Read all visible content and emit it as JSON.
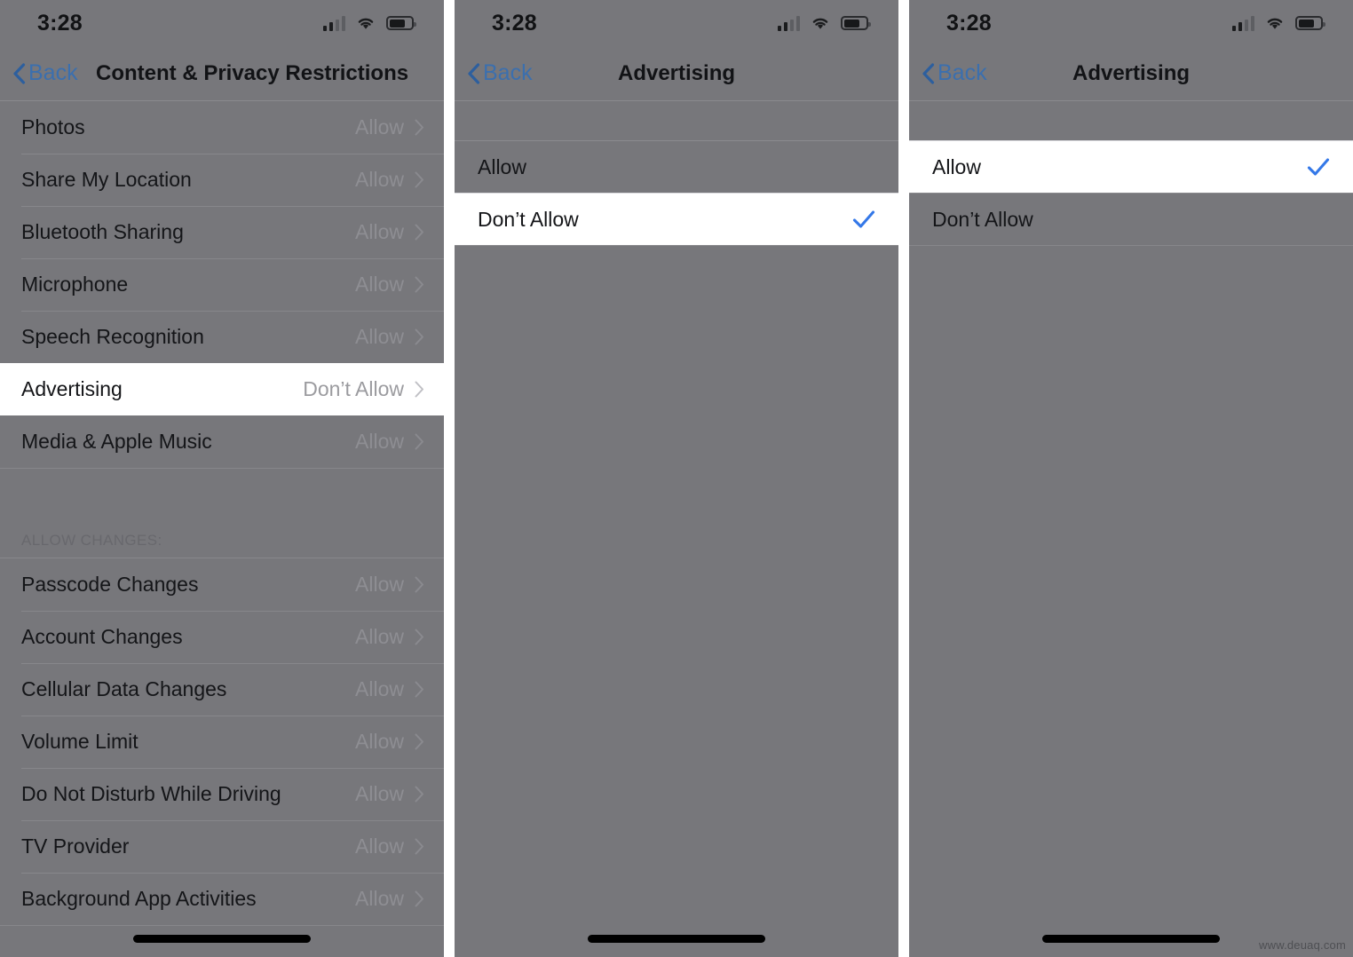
{
  "status_bar": {
    "time": "3:28",
    "icons": [
      "cellular-signal-icon",
      "wifi-icon",
      "battery-icon"
    ]
  },
  "colors": {
    "dim_overlay": "#77777b",
    "highlight_bg": "#ffffff",
    "accent_blue": "#3478e8",
    "back_link": "#3b6fae",
    "value_gray": "#8e8e93"
  },
  "panels": [
    {
      "id": "content-privacy-restrictions",
      "nav": {
        "back_label": "Back",
        "title": "Content & Privacy Restrictions"
      },
      "sections": [
        {
          "header": "",
          "rows": [
            {
              "label": "Photos",
              "value": "Allow",
              "highlighted": false
            },
            {
              "label": "Share My Location",
              "value": "Allow",
              "highlighted": false
            },
            {
              "label": "Bluetooth Sharing",
              "value": "Allow",
              "highlighted": false
            },
            {
              "label": "Microphone",
              "value": "Allow",
              "highlighted": false
            },
            {
              "label": "Speech Recognition",
              "value": "Allow",
              "highlighted": false
            },
            {
              "label": "Advertising",
              "value": "Don’t Allow",
              "highlighted": true
            },
            {
              "label": "Media & Apple Music",
              "value": "Allow",
              "highlighted": false
            }
          ]
        },
        {
          "header": "ALLOW CHANGES:",
          "rows": [
            {
              "label": "Passcode Changes",
              "value": "Allow",
              "highlighted": false
            },
            {
              "label": "Account Changes",
              "value": "Allow",
              "highlighted": false
            },
            {
              "label": "Cellular Data Changes",
              "value": "Allow",
              "highlighted": false
            },
            {
              "label": "Volume Limit",
              "value": "Allow",
              "highlighted": false
            },
            {
              "label": "Do Not Disturb While Driving",
              "value": "Allow",
              "highlighted": false
            },
            {
              "label": "TV Provider",
              "value": "Allow",
              "highlighted": false
            },
            {
              "label": "Background App Activities",
              "value": "Allow",
              "highlighted": false
            }
          ]
        }
      ]
    },
    {
      "id": "advertising-before",
      "nav": {
        "back_label": "Back",
        "title": "Advertising"
      },
      "choices": [
        {
          "label": "Allow",
          "selected": false,
          "highlighted": false
        },
        {
          "label": "Don’t Allow",
          "selected": true,
          "highlighted": true
        }
      ]
    },
    {
      "id": "advertising-after",
      "nav": {
        "back_label": "Back",
        "title": "Advertising"
      },
      "choices": [
        {
          "label": "Allow",
          "selected": true,
          "highlighted": true
        },
        {
          "label": "Don’t Allow",
          "selected": false,
          "highlighted": false
        }
      ]
    }
  ],
  "watermark": "www.deuaq.com"
}
